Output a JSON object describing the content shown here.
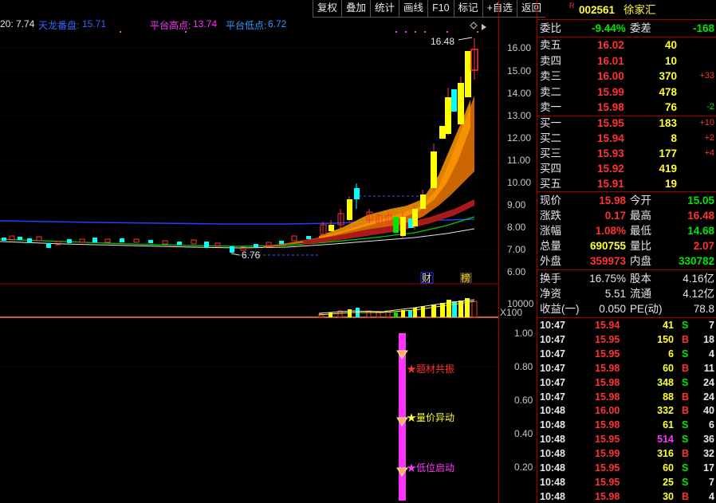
{
  "toolbar": {
    "buttons": [
      "复权",
      "叠加",
      "统计",
      "画线",
      "F10",
      "标记",
      "+自选",
      "返回"
    ]
  },
  "legend": {
    "ma_prefix": "20: 7.74",
    "tianlong_label": "天龙番盘:",
    "tianlong_value": "15.71",
    "high_label": "平台高点:",
    "high_value": "13.74",
    "low_label": "平台低点:",
    "low_value": "6.72"
  },
  "chart": {
    "price_ticks": [
      "16.00",
      "15.00",
      "14.00",
      "13.00",
      "12.00",
      "11.00",
      "10.00",
      "9.00",
      "8.00",
      "7.00",
      "6.00"
    ],
    "high_annotation": "16.48",
    "low_annotation": "6.76",
    "markers": {
      "cai": "财",
      "bang": "榜"
    },
    "volume_tick": "10000",
    "volume_unit": "X100",
    "signal_ticks": [
      "1.00",
      "0.80",
      "0.60",
      "0.40",
      "0.20"
    ],
    "signals": [
      "★题材共振",
      "★量价异动",
      "★低位启动"
    ],
    "colors": {
      "up": "#ff3232",
      "down": "#00ffff",
      "signal_bar": "#ff33ff"
    }
  },
  "quote": {
    "r_icon": "R",
    "code": "002561",
    "name": "徐家汇",
    "weibi_label": "委比",
    "weibi_value": "-9.44%",
    "weicha_label": "委差",
    "weicha_value": "-168",
    "asks": [
      {
        "label": "卖五",
        "price": "16.02",
        "vol": "40",
        "chg": ""
      },
      {
        "label": "卖四",
        "price": "16.01",
        "vol": "10",
        "chg": ""
      },
      {
        "label": "卖三",
        "price": "16.00",
        "vol": "370",
        "chg": "+33"
      },
      {
        "label": "卖二",
        "price": "15.99",
        "vol": "478",
        "chg": ""
      },
      {
        "label": "卖一",
        "price": "15.98",
        "vol": "76",
        "chg": "-2"
      }
    ],
    "bids": [
      {
        "label": "买一",
        "price": "15.95",
        "vol": "183",
        "chg": "+10"
      },
      {
        "label": "买二",
        "price": "15.94",
        "vol": "8",
        "chg": "+2"
      },
      {
        "label": "买三",
        "price": "15.93",
        "vol": "177",
        "chg": "+4"
      },
      {
        "label": "买四",
        "price": "15.92",
        "vol": "419",
        "chg": ""
      },
      {
        "label": "买五",
        "price": "15.91",
        "vol": "19",
        "chg": ""
      }
    ],
    "stats": [
      {
        "l1": "现价",
        "v1": "15.98",
        "l2": "今开",
        "v2": "15.05"
      },
      {
        "l1": "涨跌",
        "v1": "0.17",
        "l2": "最高",
        "v2": "16.48"
      },
      {
        "l1": "涨幅",
        "v1": "1.08%",
        "l2": "最低",
        "v2": "14.68"
      },
      {
        "l1": "总量",
        "v1": "690755",
        "l2": "量比",
        "v2": "2.07"
      },
      {
        "l1": "外盘",
        "v1": "359973",
        "l2": "内盘",
        "v2": "330782"
      }
    ],
    "stats2": [
      {
        "l1": "换手",
        "v1": "16.75%",
        "l2": "股本",
        "v2": "4.16亿"
      },
      {
        "l1": "净资",
        "v1": "5.51",
        "l2": "流通",
        "v2": "4.12亿"
      },
      {
        "l1": "收益(一)",
        "v1": "0.050",
        "l2": "PE(动)",
        "v2": "78.8"
      }
    ]
  },
  "ticks": [
    {
      "time": "10:47",
      "price": "15.94",
      "vol": "41",
      "bs": "S",
      "n": "7"
    },
    {
      "time": "10:47",
      "price": "15.95",
      "vol": "150",
      "bs": "B",
      "n": "18"
    },
    {
      "time": "10:47",
      "price": "15.95",
      "vol": "6",
      "bs": "S",
      "n": "4"
    },
    {
      "time": "10:47",
      "price": "15.98",
      "vol": "60",
      "bs": "B",
      "n": "11"
    },
    {
      "time": "10:47",
      "price": "15.98",
      "vol": "348",
      "bs": "S",
      "n": "24"
    },
    {
      "time": "10:47",
      "price": "15.98",
      "vol": "88",
      "bs": "B",
      "n": "24"
    },
    {
      "time": "10:48",
      "price": "16.00",
      "vol": "332",
      "bs": "B",
      "n": "40"
    },
    {
      "time": "10:48",
      "price": "15.98",
      "vol": "61",
      "bs": "S",
      "n": "6"
    },
    {
      "time": "10:48",
      "price": "15.95",
      "vol": "514",
      "bs": "S",
      "n": "36"
    },
    {
      "time": "10:48",
      "price": "15.99",
      "vol": "316",
      "bs": "B",
      "n": "32"
    },
    {
      "time": "10:48",
      "price": "15.95",
      "vol": "60",
      "bs": "S",
      "n": "17"
    },
    {
      "time": "10:48",
      "price": "15.95",
      "vol": "25",
      "bs": "S",
      "n": "7"
    },
    {
      "time": "10:48",
      "price": "15.98",
      "vol": "30",
      "bs": "B",
      "n": "4"
    }
  ]
}
